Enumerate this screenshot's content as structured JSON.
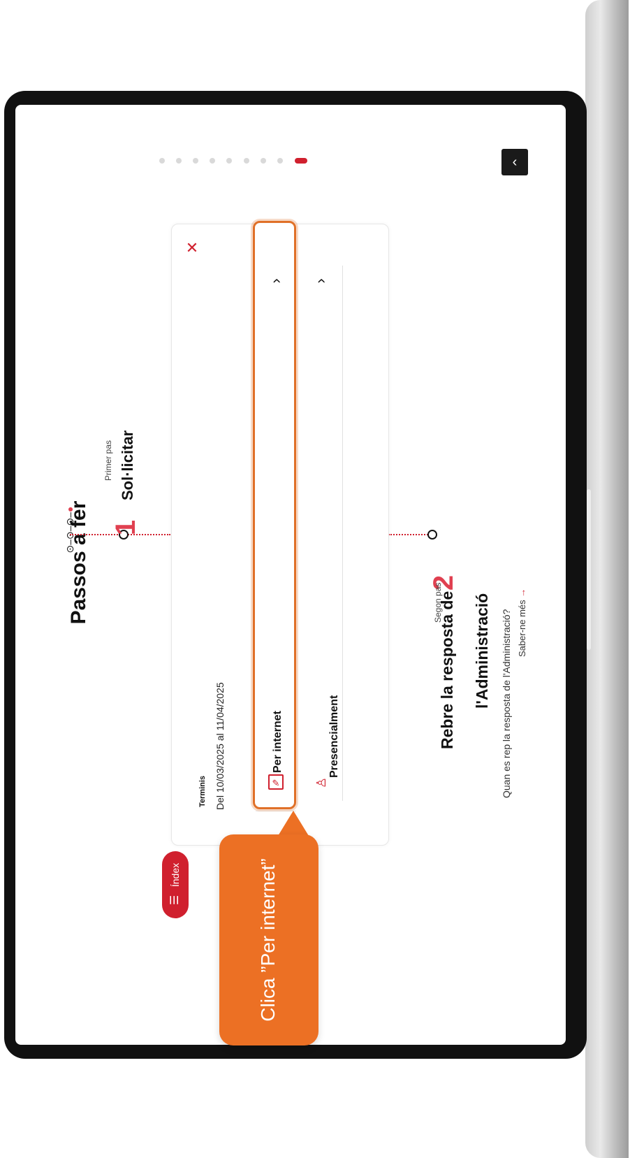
{
  "header": {
    "title": "Passos a fer",
    "mini_steps": "⊙–⊙–⊙–"
  },
  "steps": [
    {
      "number": "1",
      "caption": "Primer pas",
      "title": "Sol·licitar"
    },
    {
      "number": "2",
      "caption": "Segon pas",
      "title_line1": "Rebre la resposta de",
      "title_line2": "l'Administració",
      "question": "Quan es rep la resposta de l'Administració?",
      "more_label": "Saber-ne més"
    }
  ],
  "card": {
    "termini_label": "Terminis",
    "termini_value": "Del 10/03/2025 al 11/04/2025",
    "options": [
      {
        "label": "Per internet",
        "icon": "web-form-icon"
      },
      {
        "label": "Presencialment",
        "icon": "person-icon"
      }
    ]
  },
  "index_label": "Índex",
  "callout": {
    "text": "Clica ”Per internet”"
  },
  "pager": {
    "count": 9,
    "active_index": 8
  },
  "colors": {
    "accent": "#d0202e",
    "callout": "#ec7024"
  }
}
